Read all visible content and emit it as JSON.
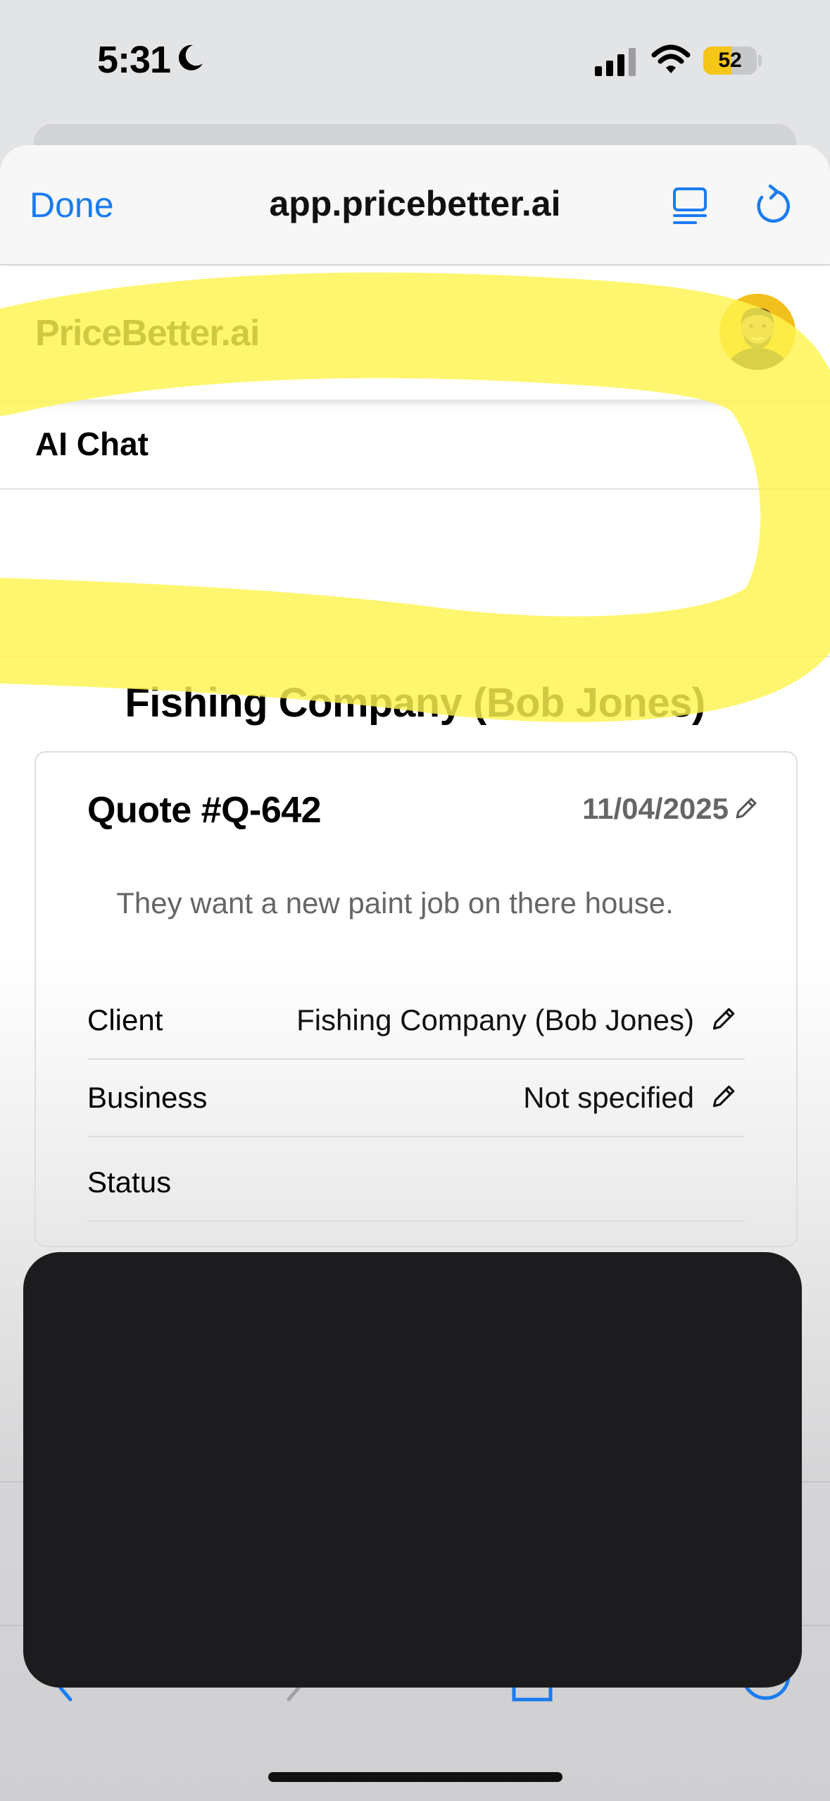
{
  "status_bar": {
    "time": "5:31",
    "battery_percent": "52",
    "battery_level": 0.52,
    "icons": [
      "moon-icon",
      "cellular-signal-icon",
      "wifi-icon",
      "battery-icon"
    ]
  },
  "browser": {
    "done_label": "Done",
    "url": "app.pricebetter.ai",
    "icons": [
      "reader-mode-icon",
      "reload-icon"
    ],
    "accent_color": "#1a7cf0"
  },
  "site": {
    "title": "PriceBetter.ai",
    "avatar_color": "#f2c01c",
    "nav_item": "AI Chat"
  },
  "quote": {
    "client_heading": "Fishing Company (Bob Jones)",
    "number": "Quote #Q-642",
    "date": "11/04/2025",
    "description": "They want a new paint job on there house.",
    "rows": [
      {
        "label": "Client",
        "value": "Fishing Company (Bob Jones)"
      },
      {
        "label": "Business",
        "value": "Not specified"
      },
      {
        "label": "Status",
        "value": ""
      }
    ]
  },
  "annotation": {
    "highlighter_color": "#fff44f"
  },
  "bottom_toolbar": {
    "icons": [
      "back-chevron-icon",
      "forward-chevron-icon",
      "share-icon",
      "compass-icon"
    ]
  }
}
